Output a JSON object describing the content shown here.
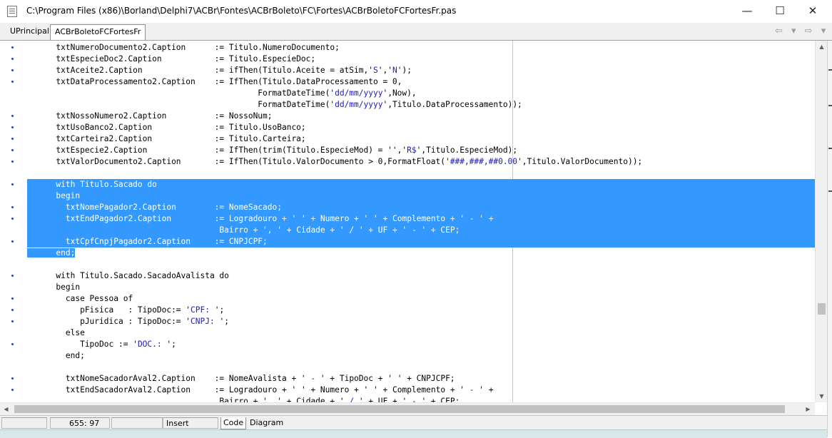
{
  "window": {
    "title": "C:\\Program Files (x86)\\Borland\\Delphi7\\ACBr\\Fontes\\ACBrBoleto\\FC\\Fortes\\ACBrBoletoFCFortesFr.pas",
    "minimize_glyph": "—",
    "maximize_glyph": "☐",
    "close_glyph": "✕"
  },
  "tabs": [
    {
      "label": "UPrincipal"
    },
    {
      "label": "ACBrBoletoFCFortesFr"
    }
  ],
  "nav": {
    "arrows": "⇦ ▾ ⇨ ▾"
  },
  "code": {
    "lines": [
      {
        "text": "      txtNumeroDocumento2.Caption      := Titulo.NumeroDocumento;",
        "dot": true
      },
      {
        "text": "      txtEspecieDoc2.Caption           := Titulo.EspecieDoc;",
        "dot": true
      },
      {
        "text": "      txtAceite2.Caption               := ifThen(Titulo.Aceite = atSim,'S','N');",
        "dot": true
      },
      {
        "text": "      txtDataProcessamento2.Caption    := IfThen(Titulo.DataProcessamento = 0,",
        "dot": true
      },
      {
        "text": "                                                FormatDateTime('dd/mm/yyyy',Now),",
        "dot": false
      },
      {
        "text": "                                                FormatDateTime('dd/mm/yyyy',Titulo.DataProcessamento));",
        "dot": false
      },
      {
        "text": "      txtNossoNumero2.Caption          := NossoNum;",
        "dot": true
      },
      {
        "text": "      txtUsoBanco2.Caption             := Titulo.UsoBanco;",
        "dot": true
      },
      {
        "text": "      txtCarteira2.Caption             := Titulo.Carteira;",
        "dot": true
      },
      {
        "text": "      txtEspecie2.Caption              := IfThen(trim(Titulo.EspecieMod) = '','R$',Titulo.EspecieMod);",
        "dot": true
      },
      {
        "text": "      txtValorDocumento2.Caption       := IfThen(Titulo.ValorDocumento > 0,FormatFloat('###,###,##0.00',Titulo.ValorDocumento));",
        "dot": true
      },
      {
        "text": "",
        "dot": false
      },
      {
        "text": "      with Titulo.Sacado do",
        "dot": true,
        "selected": true
      },
      {
        "text": "      begin",
        "dot": false,
        "selected": true
      },
      {
        "text": "        txtNomePagador2.Caption        := NomeSacado;",
        "dot": true,
        "selected": true
      },
      {
        "text": "        txtEndPagador2.Caption         := Logradouro + ' ' + Numero + ' ' + Complemento + ' - ' +",
        "dot": true,
        "selected": true
      },
      {
        "text": "                                        Bairro + ', ' + Cidade + ' / ' + UF + ' - ' + CEP;",
        "dot": false,
        "selected": true
      },
      {
        "text": "        txtCpfCnpjPagador2.Caption     := CNPJCPF;",
        "dot": true,
        "selected": true
      },
      {
        "text": "      end;",
        "dot": false,
        "selected": "partial"
      },
      {
        "text": "",
        "dot": false
      },
      {
        "text": "      with Titulo.Sacado.SacadoAvalista do",
        "dot": true
      },
      {
        "text": "      begin",
        "dot": false
      },
      {
        "text": "        case Pessoa of",
        "dot": true
      },
      {
        "text": "           pFisica   : TipoDoc:= 'CPF: ';",
        "dot": true
      },
      {
        "text": "           pJuridica : TipoDoc:= 'CNPJ: ';",
        "dot": true
      },
      {
        "text": "        else",
        "dot": false
      },
      {
        "text": "           TipoDoc := 'DOC.: ';",
        "dot": true
      },
      {
        "text": "        end;",
        "dot": false
      },
      {
        "text": "",
        "dot": false
      },
      {
        "text": "        txtNomeSacadorAval2.Caption    := NomeAvalista + ' - ' + TipoDoc + ' ' + CNPJCPF;",
        "dot": true
      },
      {
        "text": "        txtEndSacadorAval2.Caption     := Logradouro + ' ' + Numero + ' ' + Complemento + ' - ' +",
        "dot": true
      },
      {
        "text": "                                        Bairro + ', ' + Cidade + ' / ' + UF + ' - ' + CEP;",
        "dot": false
      }
    ]
  },
  "status": {
    "position": "655:  97",
    "mode": "Insert",
    "empty1": "",
    "empty2": ""
  },
  "bottom_tabs": [
    {
      "label": "Code"
    },
    {
      "label": "Diagram"
    }
  ],
  "colors": {
    "selection": "#3399ff",
    "string_literal": "#1c1cb0",
    "gutter_dot": "#1f3fbf"
  }
}
